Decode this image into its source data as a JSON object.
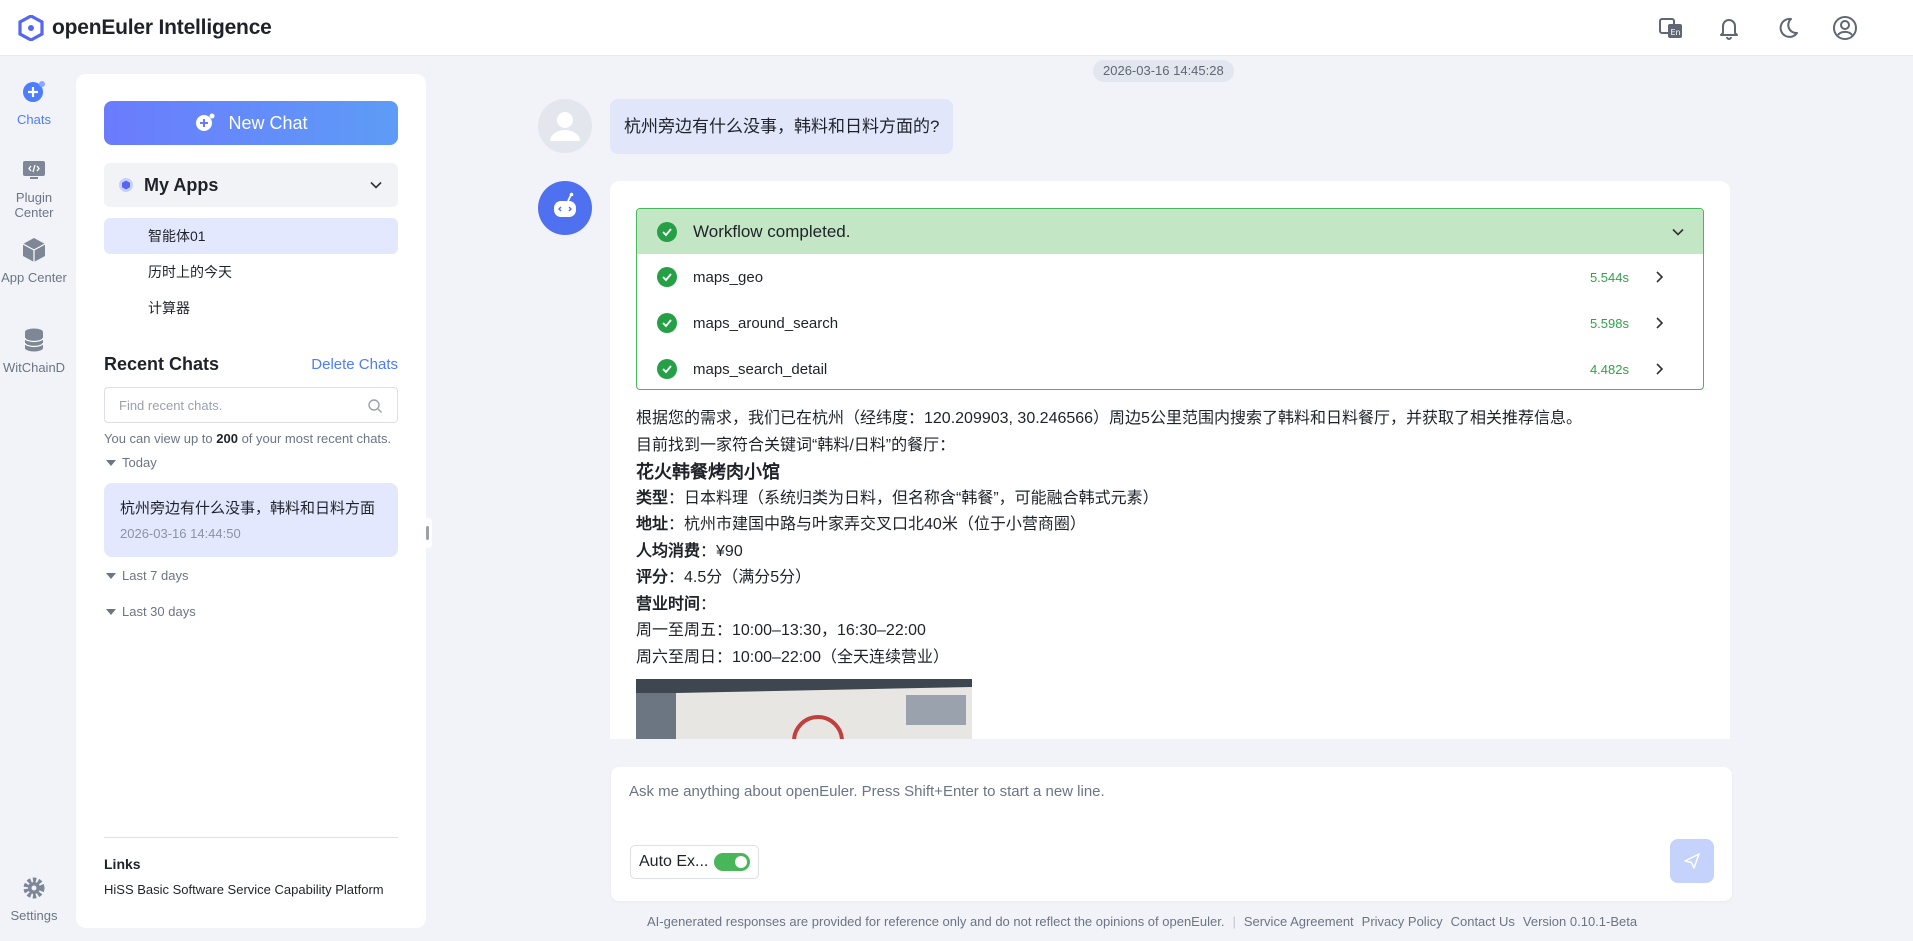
{
  "app": {
    "title": "openEuler Intelligence"
  },
  "leftnav": {
    "items": [
      {
        "label": "Chats",
        "icon": "chat-plus-icon",
        "active": true
      },
      {
        "label": "Plugin Center",
        "icon": "plugin-monitor-icon"
      },
      {
        "label": "App Center",
        "icon": "cube-icon"
      },
      {
        "label": "WitChainD",
        "icon": "database-icon"
      }
    ],
    "settings_label": "Settings"
  },
  "sidebar": {
    "new_chat_label": "New Chat",
    "my_apps_label": "My Apps",
    "apps": [
      "智能体01",
      "历时上的今天",
      "计算器"
    ],
    "recent_title": "Recent Chats",
    "delete_label": "Delete Chats",
    "search_placeholder": "Find recent chats.",
    "hint_prefix": "You can view up to ",
    "hint_count": "200",
    "hint_suffix": " of your most recent chats.",
    "groups": {
      "today": "Today",
      "last7": "Last 7 days",
      "last30": "Last 30 days"
    },
    "chat_item": {
      "title": "杭州旁边有什么没事，韩料和日料方面",
      "time": "2026-03-16 14:44:50"
    },
    "links_title": "Links",
    "links_item": "HiSS Basic Software Service Capability Platform"
  },
  "conversation": {
    "timestamp": "2026-03-16 14:45:28",
    "user_message": "杭州旁边有什么没事，韩料和日料方面的?",
    "workflow": {
      "status": "Workflow completed.",
      "steps": [
        {
          "name": "maps_geo",
          "time": "5.544s"
        },
        {
          "name": "maps_around_search",
          "time": "5.598s"
        },
        {
          "name": "maps_search_detail",
          "time": "4.482s"
        }
      ]
    },
    "answer": {
      "intro1": "根据您的需求，我们已在杭州（经纬度：120.209903, 30.246566）周边5公里范围内搜索了韩料和日料餐厅，并获取了相关推荐信息。",
      "intro2": "目前找到一家符合关键词“韩料/日料”的餐厅：",
      "name": "花火韩餐烤肉小馆",
      "type_label": "类型",
      "type_value": "：日本料理（系统归类为日料，但名称含“韩餐”，可能融合韩式元素）",
      "addr_label": "地址",
      "addr_value": "：杭州市建国中路与叶家弄交叉口北40米（位于小营商圈）",
      "price_label": "人均消费",
      "price_value": "：¥90",
      "rating_label": "评分",
      "rating_value": "：4.5分（满分5分）",
      "hours_label": "营业时间",
      "hours_value": "：",
      "hours_weekday": "周一至周五：10:00–13:30，16:30–22:00",
      "hours_weekend": "周六至周日：10:00–22:00（全天连续营业）"
    }
  },
  "composer": {
    "placeholder": "Ask me anything about openEuler. Press Shift+Enter to start a new line.",
    "auto_exec_label": "Auto Ex...",
    "auto_exec_on": true
  },
  "footer": {
    "disclaimer": "AI-generated responses are provided for reference only and do not reflect the opinions of openEuler.",
    "service": "Service Agreement",
    "privacy": "Privacy Policy",
    "contact": "Contact Us",
    "version": "Version 0.10.1-Beta"
  },
  "colors": {
    "accent": "#4d7cfe",
    "success": "#25a046",
    "success_bg": "#c3e6c5"
  }
}
